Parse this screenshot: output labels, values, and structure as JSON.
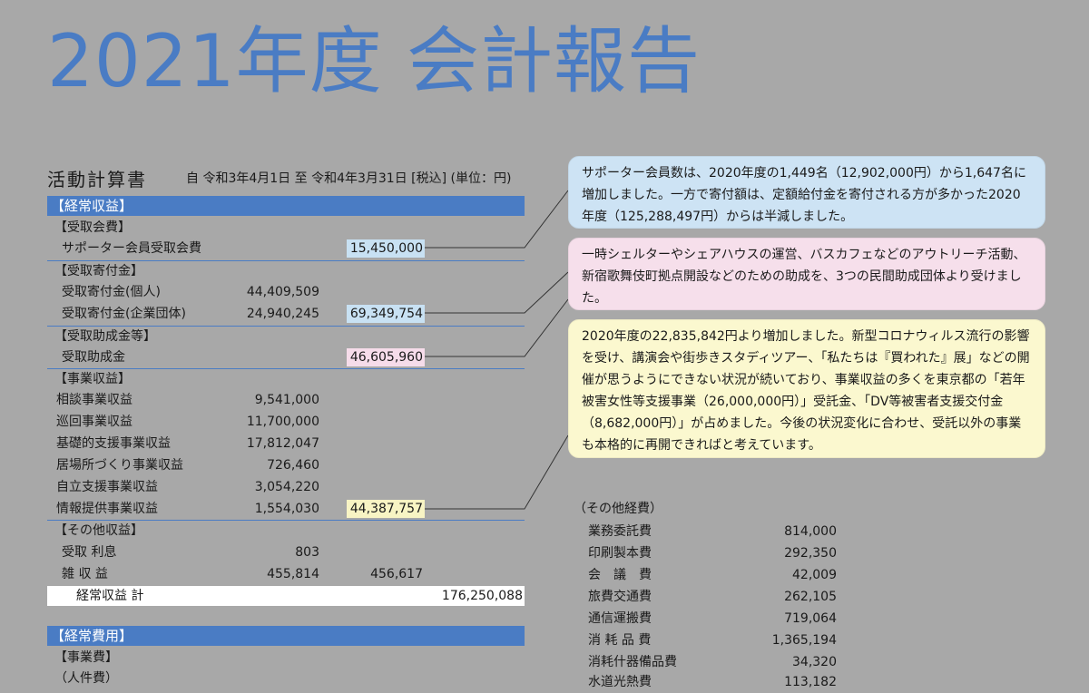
{
  "title": "2021年度 会計報告",
  "statement": {
    "heading": "活動計算書",
    "period": "自 令和3年4月1日 至 令和4年3月31日 [税込] (単位：円)"
  },
  "ordinary_revenue": {
    "bar_label": "【経常収益】",
    "membership": {
      "group": "【受取会費】",
      "item_label": "サポーター会員受取会費",
      "subtotal": "15,450,000"
    },
    "donations": {
      "group": "【受取寄付金】",
      "items": [
        {
          "label": "受取寄付金(個人)",
          "value": "44,409,509"
        },
        {
          "label": "受取寄付金(企業団体)",
          "value": "24,940,245"
        }
      ],
      "subtotal": "69,349,754"
    },
    "grants": {
      "group": "【受取助成金等】",
      "item_label": "受取助成金",
      "subtotal": "46,605,960"
    },
    "business": {
      "group": "【事業収益】",
      "items": [
        {
          "label": "相談事業収益",
          "value": "9,541,000"
        },
        {
          "label": "巡回事業収益",
          "value": "11,700,000"
        },
        {
          "label": "基礎的支援事業収益",
          "value": "17,812,047"
        },
        {
          "label": "居場所づくり事業収益",
          "value": "726,460"
        },
        {
          "label": "自立支援事業収益",
          "value": "3,054,220"
        },
        {
          "label": "情報提供事業収益",
          "value": "1,554,030"
        }
      ],
      "subtotal": "44,387,757"
    },
    "other": {
      "group": "【その他収益】",
      "items": [
        {
          "label": "受取 利息",
          "value": "803"
        },
        {
          "label": "雑 収 益",
          "value": "455,814"
        }
      ],
      "subtotal": "456,617"
    },
    "total_label": "経常収益 計",
    "total_value": "176,250,088"
  },
  "ordinary_expense": {
    "bar_label": "【経常費用】",
    "group": "【事業費】",
    "sub": "（人件費）"
  },
  "notes": {
    "membership": "サポーター会員数は、2020年度の1,449名（12,902,000円）から1,647名に増加しました。一方で寄付額は、定額給付金を寄付される方が多かった2020年度（125,288,497円）からは半減しました。",
    "grants": "一時シェルターやシェアハウスの運営、バスカフェなどのアウトリーチ活動、新宿歌舞伎町拠点開設などのための助成を、3つの民間助成団体より受けました。",
    "business": "2020年度の22,835,842円より増加しました。新型コロナウィルス流行の影響を受け、講演会や街歩きスタディツアー、「私たちは『買われた』展」などの開催が思うようにできない状況が続いており、事業収益の多くを東京都の「若年被害女性等支援事業（26,000,000円）」受託金、「DV等被害者支援交付金（8,682,000円）」が占めました。今後の状況変化に合わせ、受託以外の事業も本格的に再開できればと考えています。"
  },
  "other_expenses": {
    "heading": "（その他経費）",
    "items": [
      {
        "label": "業務委託費",
        "value": "814,000"
      },
      {
        "label": "印刷製本費",
        "value": "292,350"
      },
      {
        "label": "会　議　費",
        "value": "42,009"
      },
      {
        "label": "旅費交通費",
        "value": "262,105"
      },
      {
        "label": "通信運搬費",
        "value": "719,064"
      },
      {
        "label": "消 耗 品 費",
        "value": "1,365,194"
      },
      {
        "label": "消耗什器備品費",
        "value": "34,320"
      },
      {
        "label": "水道光熱費",
        "value": "113,182"
      }
    ]
  },
  "colors": {
    "accent": "#4a7cc4",
    "background": "#a8a8a8",
    "note_blue": "#cde3f4",
    "note_pink": "#f6dfeb",
    "note_yellow": "#fbf8cf"
  }
}
